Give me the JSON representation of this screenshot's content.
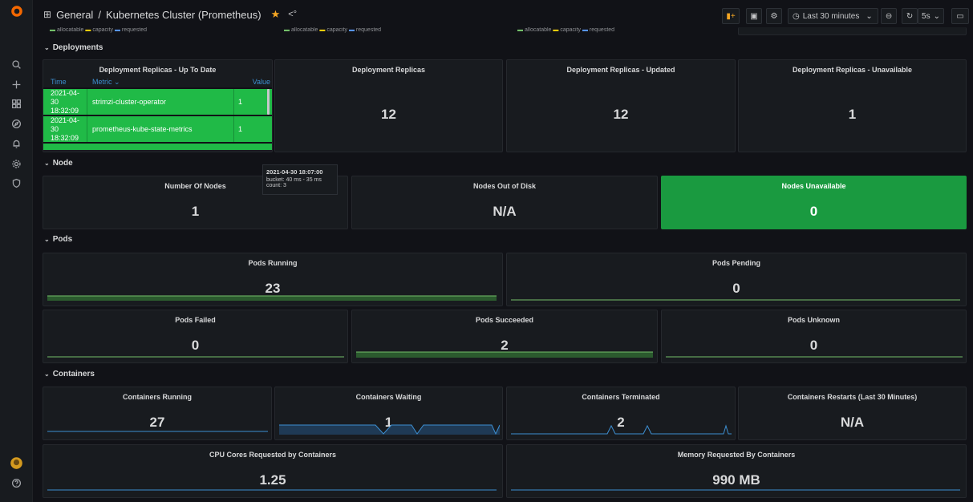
{
  "topbar": {
    "breadcrumb_folder": "General",
    "breadcrumb_sep": "/",
    "dashboard_title": "Kubernetes Cluster (Prometheus)",
    "time_range": "Last 30 minutes",
    "refresh_interval": "5s"
  },
  "legend": {
    "allocatable": "allocatable",
    "capacity": "capacity",
    "requested": "requested"
  },
  "rows": {
    "deployments": "Deployments",
    "node": "Node",
    "pods": "Pods",
    "containers": "Containers"
  },
  "deployments": {
    "table_title": "Deployment Replicas - Up To Date",
    "columns": [
      "Time",
      "Metric",
      "Value"
    ],
    "rows": [
      {
        "time_date": "2021-04-30",
        "time_clock": "18:32:09",
        "metric": "strimzi-cluster-operator",
        "value": "1"
      },
      {
        "time_date": "2021-04-30",
        "time_clock": "18:32:09",
        "metric": "prometheus-kube-state-metrics",
        "value": "1"
      }
    ],
    "replicas": {
      "title": "Deployment Replicas",
      "value": "12"
    },
    "updated": {
      "title": "Deployment Replicas - Updated",
      "value": "12"
    },
    "unavailable": {
      "title": "Deployment Replicas - Unavailable",
      "value": "1"
    }
  },
  "tooltip": {
    "title": "2021-04-30 18:07:00",
    "line1": "bucket: 40 ms - 35 ms",
    "line2": "count: 3"
  },
  "node": {
    "number": {
      "title": "Number Of Nodes",
      "value": "1"
    },
    "out_of_disk": {
      "title": "Nodes Out of Disk",
      "value": "N/A"
    },
    "unavailable": {
      "title": "Nodes Unavailable",
      "value": "0"
    }
  },
  "pods": {
    "running": {
      "title": "Pods Running",
      "value": "23"
    },
    "pending": {
      "title": "Pods Pending",
      "value": "0"
    },
    "failed": {
      "title": "Pods Failed",
      "value": "0"
    },
    "succeeded": {
      "title": "Pods Succeeded",
      "value": "2"
    },
    "unknown": {
      "title": "Pods Unknown",
      "value": "0"
    }
  },
  "containers": {
    "running": {
      "title": "Containers Running",
      "value": "27"
    },
    "waiting": {
      "title": "Containers Waiting",
      "value": "1"
    },
    "terminated": {
      "title": "Containers Terminated",
      "value": "2"
    },
    "restarts": {
      "title": "Containers Restarts (Last 30 Minutes)",
      "value": "N/A"
    },
    "cpu": {
      "title": "CPU Cores Requested by Containers",
      "value": "1.25"
    },
    "memory": {
      "title": "Memory Requested By Containers",
      "value": "990 MB"
    }
  },
  "colors": {
    "background": "#111217",
    "panel": "#181b1f",
    "green": "#20ba47",
    "accent_blue": "#3d8fd1",
    "star": "#f5a623"
  }
}
